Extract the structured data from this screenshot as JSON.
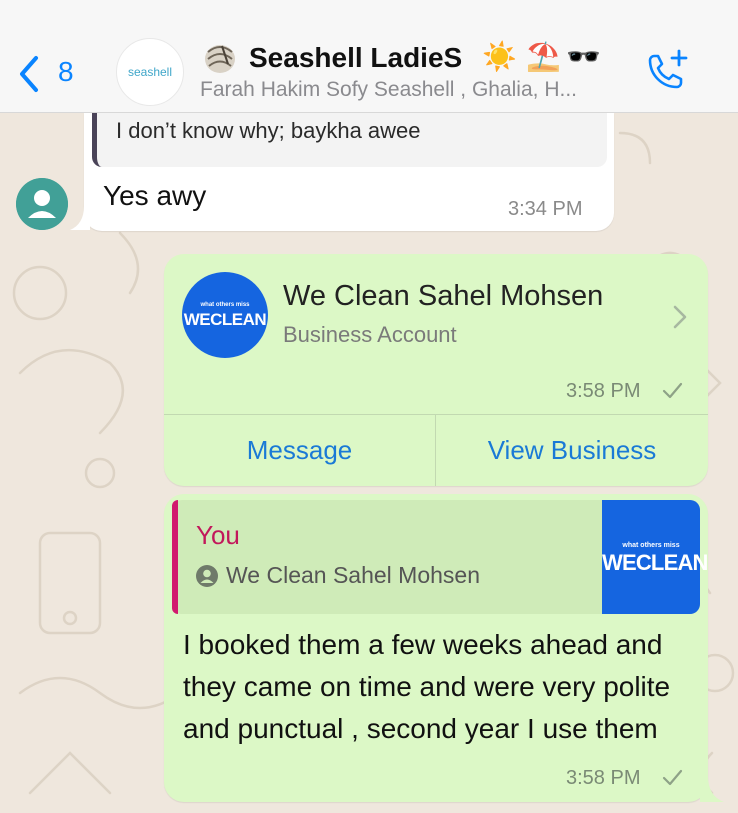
{
  "header": {
    "back_count": "8",
    "group_avatar_text": "seashell",
    "group_title": "Seashell LadieS",
    "title_emojis": [
      "☀️",
      "⛱️",
      "🕶️"
    ],
    "group_subtitle": "Farah Hakim Sofy Seashell , Ghalia, H..."
  },
  "chat": {
    "incoming": {
      "quoted_text": "I don’t know why; baykha awee",
      "text": "Yes awy",
      "time": "3:34 PM"
    },
    "contact_card": {
      "avatar_tagline": "what others miss",
      "avatar_brand": "WECLEAN",
      "name": "We Clean Sahel Mohsen",
      "subtitle": "Business Account",
      "time": "3:58 PM",
      "button_message": "Message",
      "button_view_business": "View Business"
    },
    "reply": {
      "quote_author": "You",
      "quote_contact_name": "We Clean Sahel Mohsen",
      "thumb_tagline": "what others miss",
      "thumb_brand": "WECLEAN",
      "text": "I booked them a few weeks ahead and they came on time and were very polite and punctual , second year I use them",
      "time": "3:58 PM"
    }
  },
  "colors": {
    "accent_blue": "#0a84ff",
    "outgoing_bubble": "#dcf8c6",
    "brand_blue": "#1565e0",
    "quote_author": "#c2185b"
  }
}
